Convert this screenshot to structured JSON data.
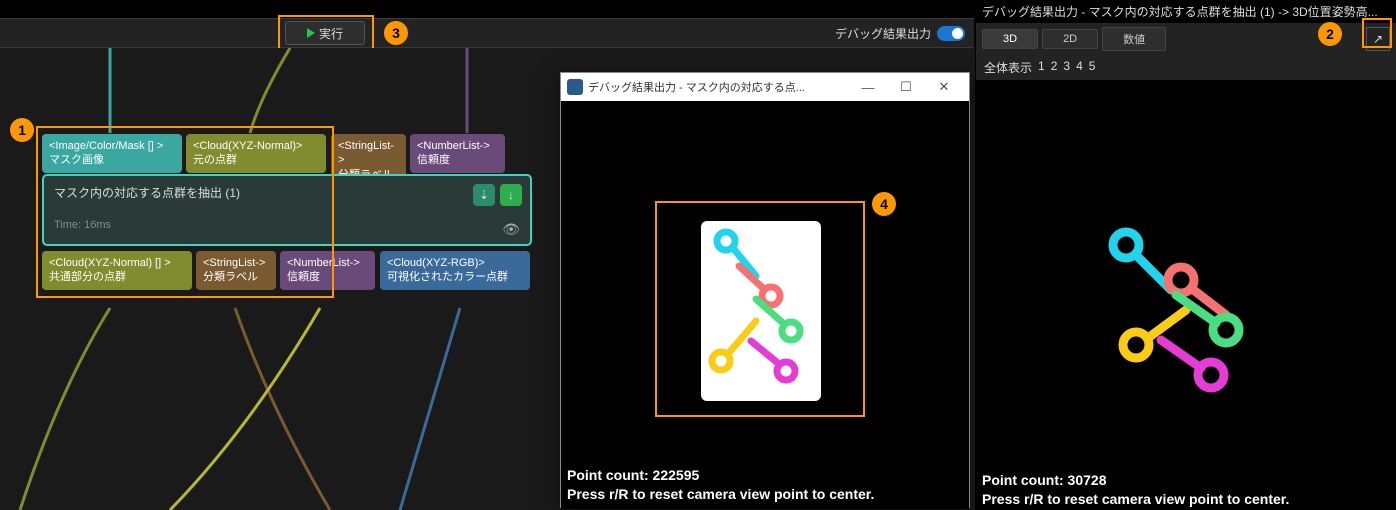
{
  "topbar": {
    "run_label": "実行",
    "debug_output_label": "デバッグ結果出力"
  },
  "callouts": {
    "one": "1",
    "two": "2",
    "three": "3",
    "four": "4"
  },
  "node": {
    "inputs": [
      {
        "type": "<Image/Color/Mask [] >",
        "label": "マスク画像",
        "color": "teal"
      },
      {
        "type": "<Cloud(XYZ-Normal)>",
        "label": "元の点群",
        "color": "olive"
      },
      {
        "type": "<StringList->",
        "label": "分類ラベル",
        "color": "brown"
      },
      {
        "type": "<NumberList->",
        "label": "信頼度",
        "color": "purple"
      }
    ],
    "title": "マスク内の対応する点群を抽出 (1)",
    "time": "Time: 16ms",
    "outputs": [
      {
        "type": "<Cloud(XYZ-Normal) [] >",
        "label": "共通部分の点群",
        "color": "olive"
      },
      {
        "type": "<StringList->",
        "label": "分類ラベル",
        "color": "brown"
      },
      {
        "type": "<NumberList->",
        "label": "信頼度",
        "color": "purple"
      },
      {
        "type": "<Cloud(XYZ-RGB)>",
        "label": "可視化されたカラー点群",
        "color": "bluep"
      }
    ]
  },
  "popup": {
    "title": "デバッグ結果出力 - マスク内の対応する点...",
    "minimize": "—",
    "maximize": "☐",
    "close": "✕",
    "point_count_label": "Point count:",
    "point_count": "222595",
    "reset_hint": "Press r/R to reset camera view point to center."
  },
  "right": {
    "title": "デバッグ結果出力 - マスク内の対応する点群を抽出 (1) -> 3D位置姿勢高...",
    "tabs": {
      "t1": "3D",
      "t2": "2D",
      "t3": "数値"
    },
    "popout_icon": "↗",
    "index_label": "全体表示",
    "indices": [
      "1",
      "2",
      "3",
      "4",
      "5"
    ],
    "point_count_label": "Point count:",
    "point_count": "30728",
    "reset_hint": "Press r/R to reset camera view point to center."
  }
}
